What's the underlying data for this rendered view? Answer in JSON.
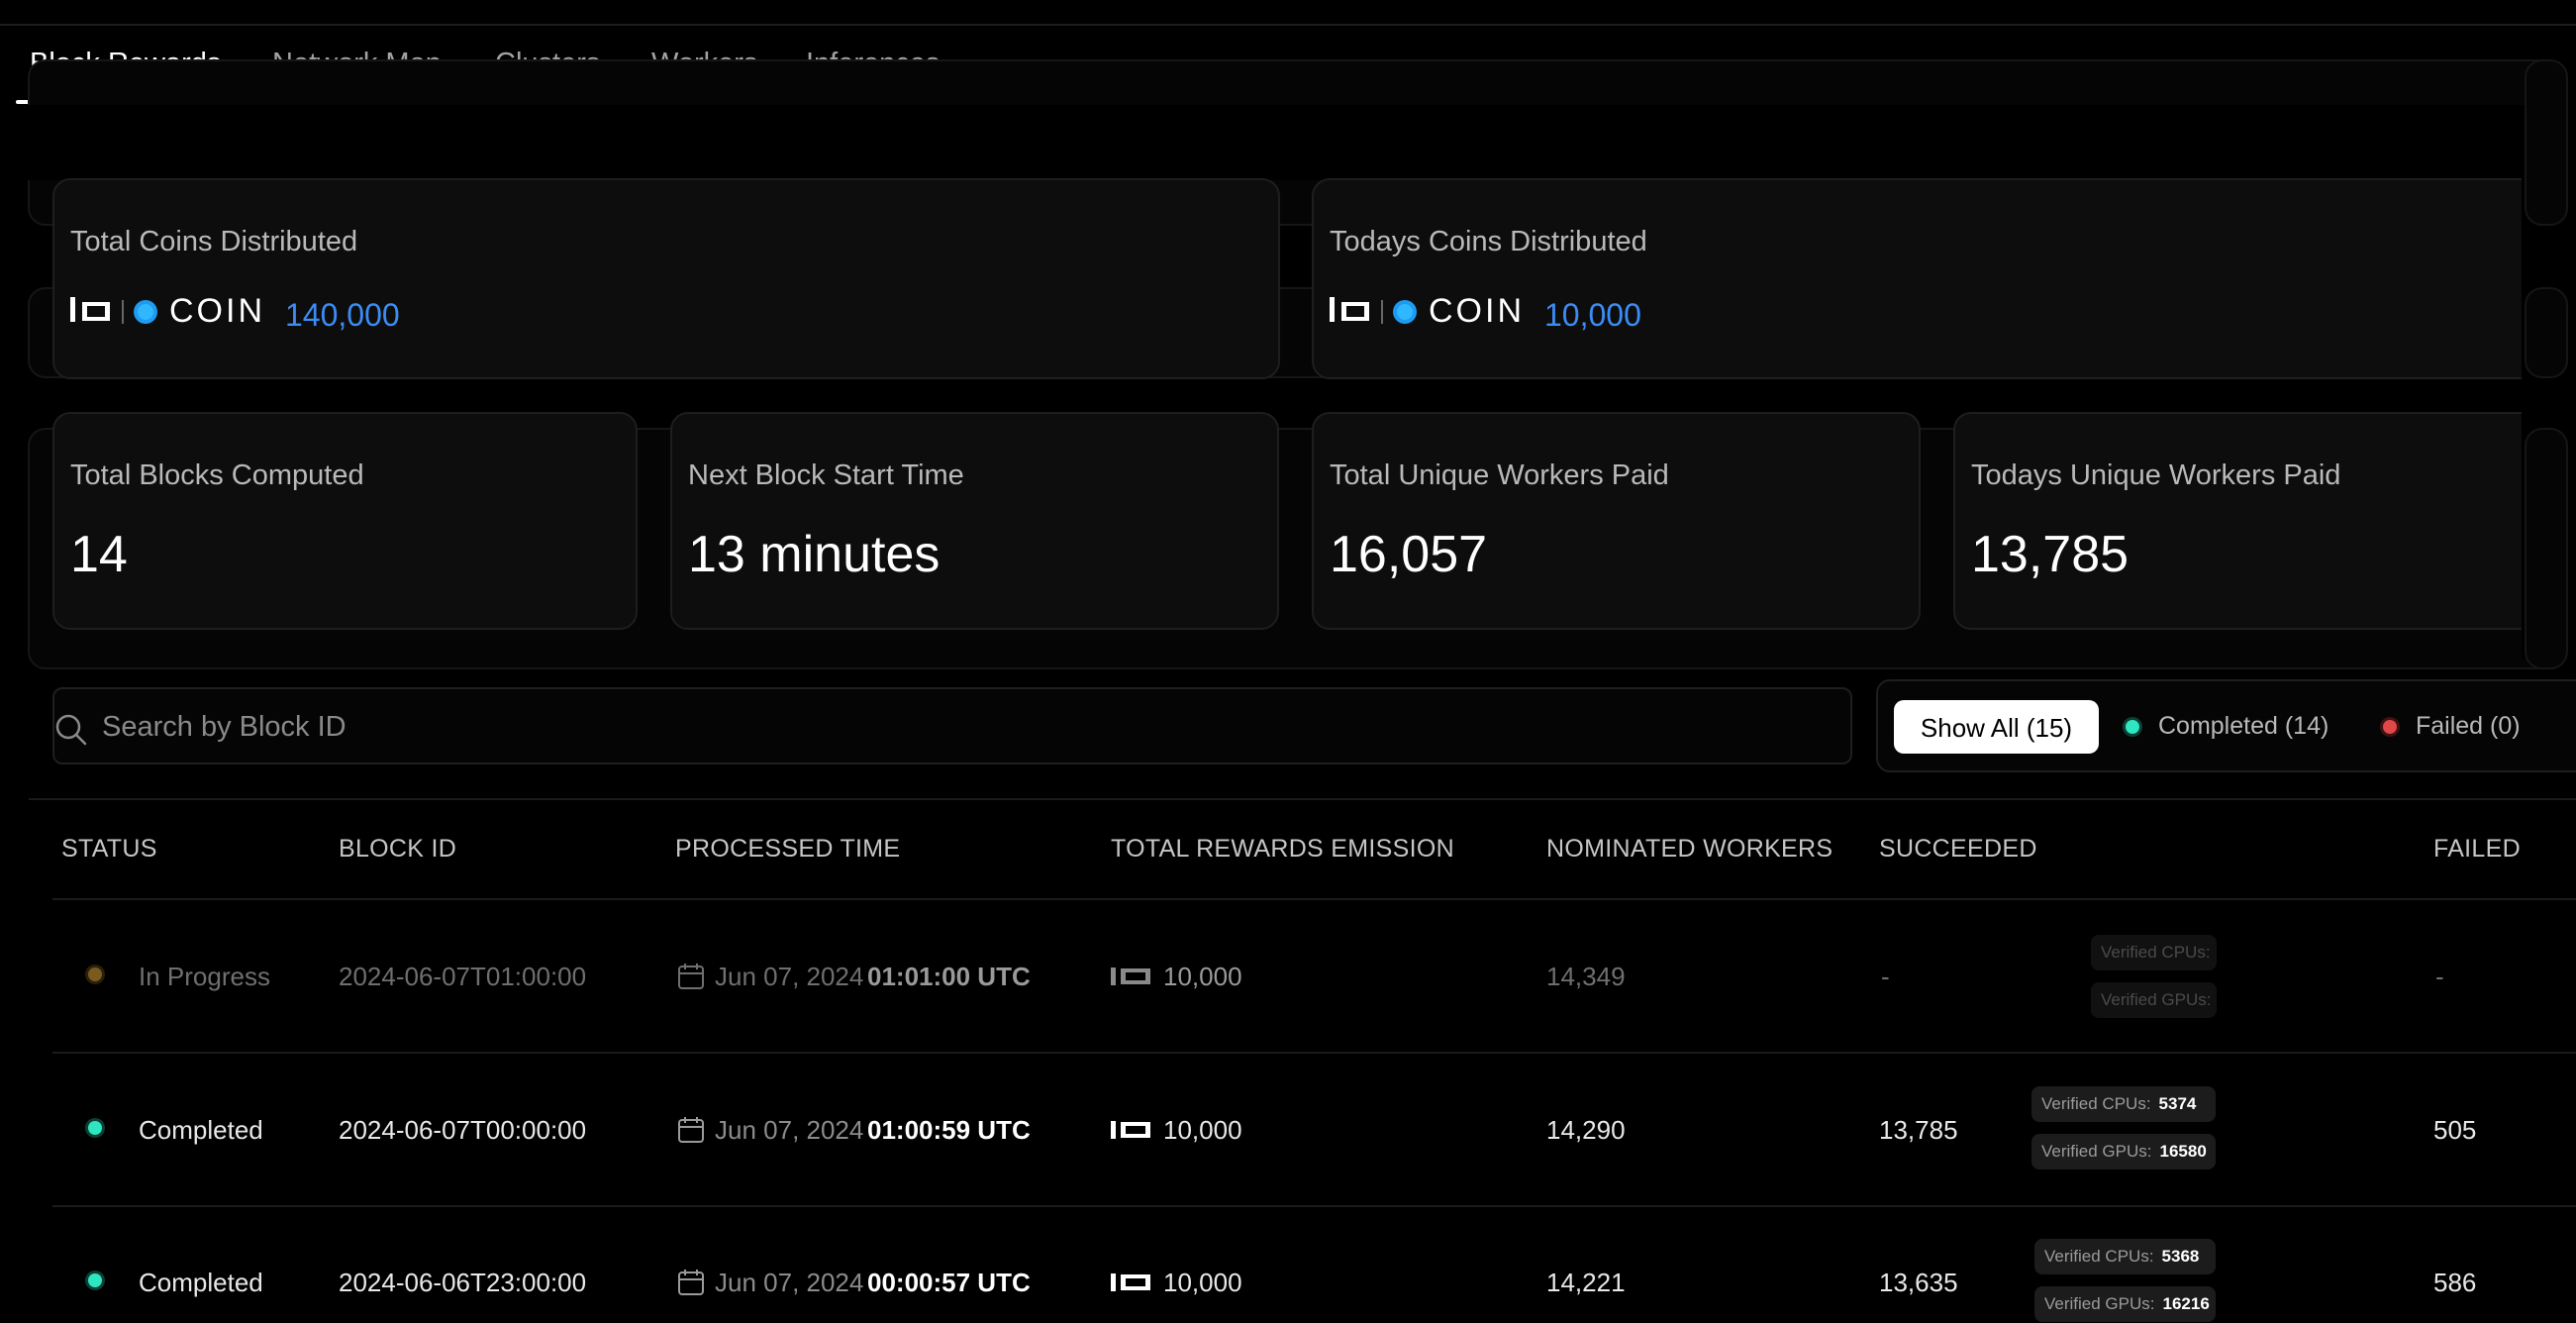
{
  "nav": {
    "tabs": [
      {
        "label": "Block Rewards",
        "active": true
      },
      {
        "label": "Network Map",
        "active": false
      },
      {
        "label": "Clusters",
        "active": false
      },
      {
        "label": "Workers",
        "active": false
      },
      {
        "label": "Inferences",
        "active": false
      }
    ]
  },
  "stats": {
    "total_coins": {
      "label": "Total Coins Distributed",
      "value": "140,000"
    },
    "todays_coins": {
      "label": "Todays Coins Distributed",
      "value": "10,000"
    },
    "total_blocks": {
      "label": "Total Blocks Computed",
      "value": "14"
    },
    "next_block": {
      "label": "Next Block Start Time",
      "value": "13 minutes"
    },
    "total_workers": {
      "label": "Total Unique Workers Paid",
      "value": "16,057"
    },
    "todays_workers": {
      "label": "Todays Unique Workers Paid",
      "value": "13,785"
    }
  },
  "coin_logo": {
    "brand": "io",
    "text": "COIN"
  },
  "search": {
    "placeholder": "Search by Block ID"
  },
  "filters": {
    "all": "Show All (15)",
    "completed": "Completed (14)",
    "failed": "Failed (0)"
  },
  "table": {
    "headers": [
      "STATUS",
      "BLOCK ID",
      "PROCESSED TIME",
      "TOTAL REWARDS EMISSION",
      "NOMINATED WORKERS",
      "SUCCEEDED",
      "FAILED"
    ],
    "rows": [
      {
        "status": "In Progress",
        "block_id": "2024-06-07T01:00:00",
        "date": "Jun 07, 2024",
        "time": "01:01:00 UTC",
        "emission": "10,000",
        "nominated": "14,349",
        "succeeded": "-",
        "cpu_label": "Verified CPUs:",
        "cpu": "",
        "gpu_label": "Verified GPUs:",
        "gpu": "",
        "failed": "-"
      },
      {
        "status": "Completed",
        "block_id": "2024-06-07T00:00:00",
        "date": "Jun 07, 2024",
        "time": "01:00:59 UTC",
        "emission": "10,000",
        "nominated": "14,290",
        "succeeded": "13,785",
        "cpu_label": "Verified CPUs:",
        "cpu": "5374",
        "gpu_label": "Verified GPUs:",
        "gpu": "16580",
        "failed": "505"
      },
      {
        "status": "Completed",
        "block_id": "2024-06-06T23:00:00",
        "date": "Jun 07, 2024",
        "time": "00:00:57 UTC",
        "emission": "10,000",
        "nominated": "14,221",
        "succeeded": "13,635",
        "cpu_label": "Verified CPUs:",
        "cpu": "5368",
        "gpu_label": "Verified GPUs:",
        "gpu": "16216",
        "failed": "586"
      }
    ]
  },
  "colors": {
    "accent_blue": "#3b8cf4",
    "completed": "#2ee6c0",
    "in_progress": "#8a6a2a",
    "failed": "#e04848"
  }
}
